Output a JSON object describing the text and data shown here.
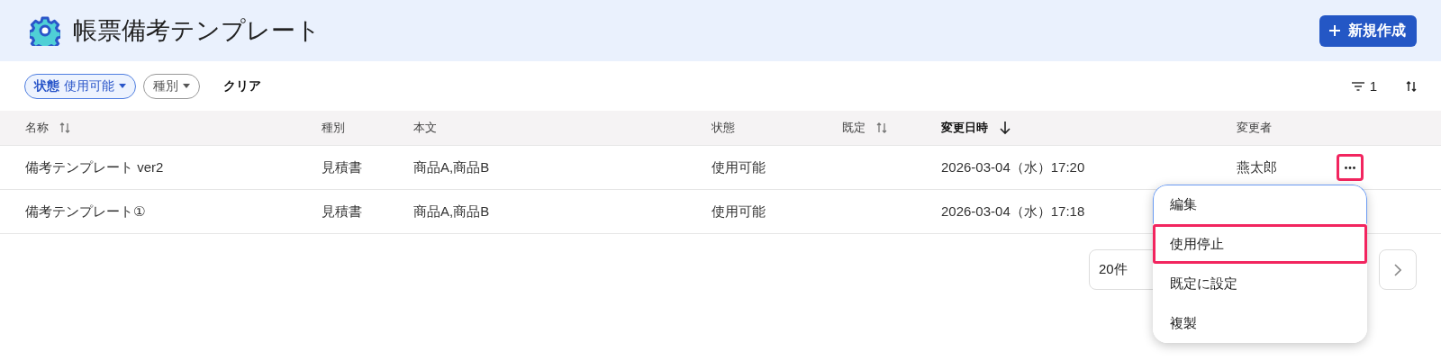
{
  "header": {
    "title": "帳票備考テンプレート",
    "new_button": "新規作成"
  },
  "filters": {
    "chips": [
      {
        "label": "状態",
        "value": "使用可能",
        "active": true
      },
      {
        "label": "種別",
        "active": false
      }
    ],
    "clear": "クリア",
    "filter_count": "1"
  },
  "table": {
    "columns": [
      {
        "label": "名称",
        "sortable": true,
        "sorted_descending": false
      },
      {
        "label": "種別",
        "sortable": false,
        "sorted_descending": false
      },
      {
        "label": "本文",
        "sortable": false,
        "sorted_descending": false
      },
      {
        "label": "状態",
        "sortable": false,
        "sorted_descending": false
      },
      {
        "label": "既定",
        "sortable": true,
        "sorted_descending": false
      },
      {
        "label": "変更日時",
        "sortable": true,
        "sorted_descending": true
      },
      {
        "label": "変更者",
        "sortable": false,
        "sorted_descending": false
      }
    ],
    "rows": [
      {
        "cells": [
          "備考テンプレート ver2",
          "見積書",
          "商品A,商品B",
          "使用可能",
          "",
          "2026-03-04（水）17:20",
          "燕太郎"
        ],
        "menu_open": true
      },
      {
        "cells": [
          "備考テンプレート①",
          "見積書",
          "商品A,商品B",
          "使用可能",
          "",
          "2026-03-04（水）17:18",
          ""
        ],
        "menu_open": false
      }
    ]
  },
  "row_menu": {
    "items": [
      {
        "label": "編集",
        "focused": true,
        "highlighted": false
      },
      {
        "label": "使用停止",
        "focused": false,
        "highlighted": true
      },
      {
        "label": "既定に設定",
        "focused": false,
        "highlighted": false
      },
      {
        "label": "複製",
        "focused": false,
        "highlighted": false
      }
    ]
  },
  "pagination": {
    "page_size": "20件"
  }
}
